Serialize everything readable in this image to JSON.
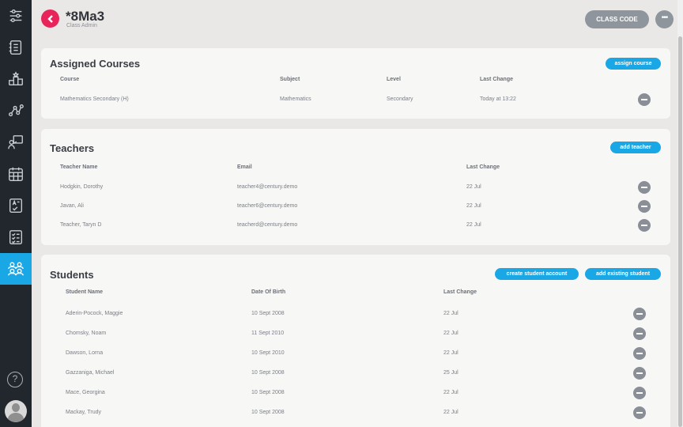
{
  "header": {
    "title": "*8Ma3",
    "subtitle": "Class Admin",
    "class_code_label": "CLASS CODE",
    "more_label": "•••"
  },
  "sidebar": {
    "items": [
      {
        "icon": "sliders-icon"
      },
      {
        "icon": "notebook-icon"
      },
      {
        "icon": "podium-icon"
      },
      {
        "icon": "network-icon"
      },
      {
        "icon": "presentation-icon"
      },
      {
        "icon": "calendar-icon"
      },
      {
        "icon": "assessment-icon"
      },
      {
        "icon": "checklist-icon"
      },
      {
        "icon": "people-icon",
        "active": true
      }
    ],
    "help_label": "?",
    "active_color": "#1aa7e6"
  },
  "courses": {
    "title": "Assigned Courses",
    "button": "assign course",
    "headers": [
      "Course",
      "Subject",
      "Level",
      "Last Change"
    ],
    "rows": [
      [
        "Mathematics Secondary (H)",
        "Mathematics",
        "Secondary",
        "Today at 13:22"
      ]
    ]
  },
  "teachers": {
    "title": "Teachers",
    "button": "add teacher",
    "headers": [
      "Teacher Name",
      "Email",
      "Last Change"
    ],
    "rows": [
      [
        "Hodgkin, Dorothy",
        "teacher4@century.demo",
        "22 Jul"
      ],
      [
        "Javan, Ali",
        "teacher6@century.demo",
        "22 Jul"
      ],
      [
        "Teacher, Taryn D",
        "teacherd@century.demo",
        "22 Jul"
      ]
    ]
  },
  "students": {
    "title": "Students",
    "button_create": "create student account",
    "button_add": "add existing student",
    "headers": [
      "Student Name",
      "Date Of Birth",
      "Last Change"
    ],
    "rows": [
      [
        "Aderin-Pocock, Maggie",
        "10 Sept 2008",
        "22 Jul"
      ],
      [
        "Chomsky, Noam",
        "11 Sept 2010",
        "22 Jul"
      ],
      [
        "Dawson, Lorna",
        "10 Sept 2010",
        "22 Jul"
      ],
      [
        "Gazzaniga, Michael",
        "10 Sept 2008",
        "25 Jul"
      ],
      [
        "Mace, Georgina",
        "10 Sept 2008",
        "22 Jul"
      ],
      [
        "Mackay, Trudy",
        "10 Sept 2008",
        "22 Jul"
      ]
    ]
  },
  "colors": {
    "accent": "#1aa7e6",
    "back_button": "#e8245b",
    "sidebar_bg": "#22262d"
  }
}
